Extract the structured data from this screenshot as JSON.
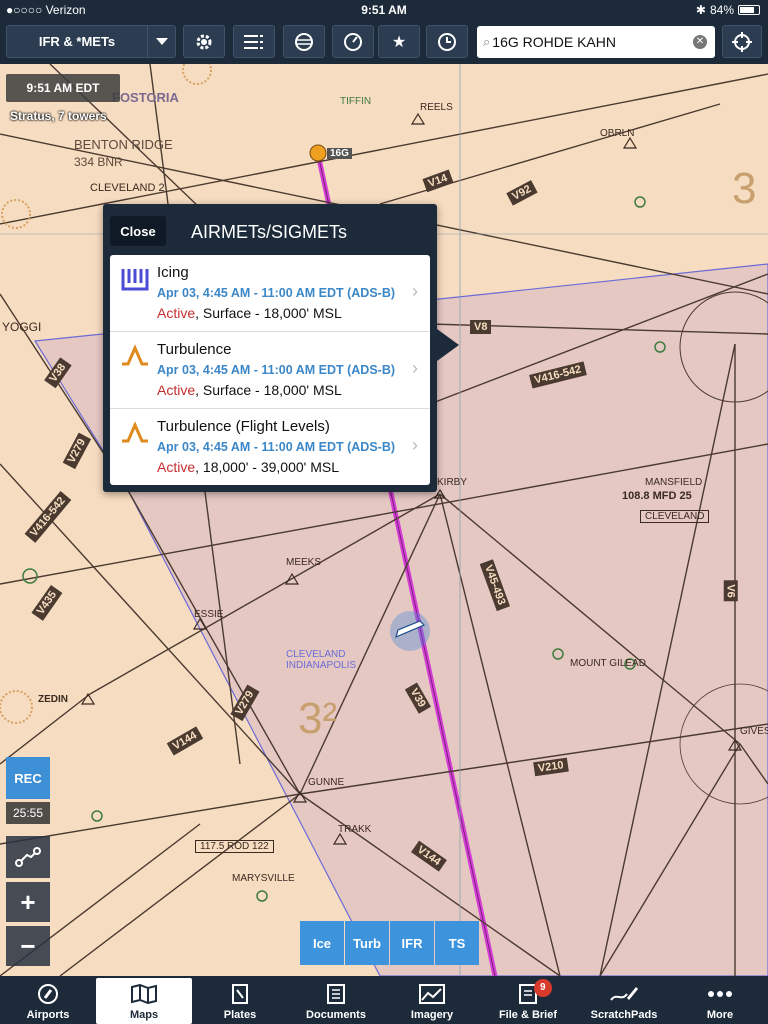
{
  "status_bar": {
    "carrier": "●○○○○ Verizon",
    "time": "9:51 AM",
    "battery": "84%"
  },
  "toolbar": {
    "layer_select": "IFR & *METs",
    "search_value": "16G ROHDE KAHN"
  },
  "map": {
    "time_chip": "9:51 AM EDT",
    "stratus": "Stratus, 7 towers",
    "labels": {
      "fostoria": "FOSTORIA",
      "benton": "BENTON RIDGE",
      "benton_freq": "334 BNR",
      "cleveland2": "CLEVELAND 2",
      "tiffin": "TIFFIN",
      "g16": "16G",
      "mansfield": "MANSFIELD",
      "mansfield_freq": "108.8 MFD 25",
      "mansfield_sub": "CLEVELAND",
      "meeks": "MEEKS",
      "essie": "ESSIE",
      "gunne": "GUNNE",
      "trakk": "TRAKK",
      "gives": "GIVES",
      "kirby": "KIRBY",
      "reels": "REELS",
      "obrln": "OBRLN",
      "zedin": "ZEDIN",
      "mount_gilead": "MOUNT GILEAD",
      "cleveland_indy": "CLEVELAND\nINDIANAPOLIS",
      "rod": "117.5 ROD 122",
      "marysville": "MARYSVILLE",
      "big3": "3",
      "big32": "3²",
      "yoggi": "YOGGI"
    },
    "airways": [
      "V14",
      "V92",
      "V8",
      "V416-542",
      "V38",
      "V279",
      "V416-542",
      "V435",
      "V144",
      "V210",
      "V39",
      "V45-493",
      "V6",
      "V144",
      "V279"
    ]
  },
  "popover": {
    "close_label": "Close",
    "title": "AIRMETs/SIGMETs",
    "items": [
      {
        "name": "Icing",
        "when": "Apr 03, 4:45 AM - 11:00 AM EDT (ADS-B)",
        "status_word": "Active",
        "status_rest": ", Surface - 18,000' MSL",
        "icon": "icing-icon"
      },
      {
        "name": "Turbulence",
        "when": "Apr 03, 4:45 AM - 11:00 AM EDT (ADS-B)",
        "status_word": "Active",
        "status_rest": ", Surface - 18,000' MSL",
        "icon": "turbulence-icon"
      },
      {
        "name": "Turbulence (Flight Levels)",
        "when": "Apr 03, 4:45 AM - 11:00 AM EDT (ADS-B)",
        "status_word": "Active",
        "status_rest": ", 18,000' - 39,000' MSL",
        "icon": "turbulence-icon"
      }
    ]
  },
  "controls": {
    "rec": "REC",
    "rec_time": "25:55",
    "zoom_in": "+",
    "zoom_out": "−"
  },
  "filters": [
    "Ice",
    "Turb",
    "IFR",
    "TS"
  ],
  "tabs": [
    {
      "label": "Airports",
      "icon": "airports-icon"
    },
    {
      "label": "Maps",
      "icon": "maps-icon"
    },
    {
      "label": "Plates",
      "icon": "plates-icon"
    },
    {
      "label": "Documents",
      "icon": "documents-icon"
    },
    {
      "label": "Imagery",
      "icon": "imagery-icon"
    },
    {
      "label": "File & Brief",
      "icon": "file-brief-icon",
      "badge": "9"
    },
    {
      "label": "ScratchPads",
      "icon": "scratchpads-icon"
    },
    {
      "label": "More",
      "icon": "more-icon"
    }
  ],
  "colors": {
    "chart_bg": "#f6dcc0",
    "airmet_area": "#e7c9c2",
    "route": "#d63fd6",
    "accent": "#3d93dc",
    "toolbar": "#1c2a3a",
    "active": "#c62e2e"
  }
}
